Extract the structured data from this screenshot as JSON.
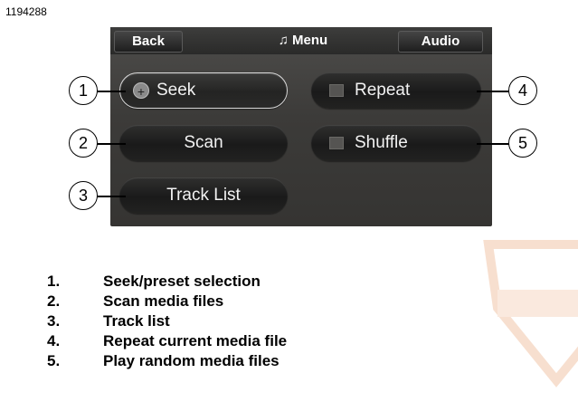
{
  "figure_id": "1194288",
  "topbar": {
    "back_label": "Back",
    "title": "Menu",
    "title_icon": "music-note-icon",
    "audio_label": "Audio"
  },
  "buttons": {
    "seek": "Seek",
    "scan": "Scan",
    "track_list": "Track List",
    "repeat": "Repeat",
    "shuffle": "Shuffle"
  },
  "callouts": [
    "1",
    "2",
    "3",
    "4",
    "5"
  ],
  "legend": [
    {
      "num": "1.",
      "text": "Seek/preset selection"
    },
    {
      "num": "2.",
      "text": "Scan media files"
    },
    {
      "num": "3.",
      "text": "Track list"
    },
    {
      "num": "4.",
      "text": "Repeat current media file"
    },
    {
      "num": "5.",
      "text": "Play random media files"
    }
  ],
  "colors": {
    "screen_bg": "#3c3b39",
    "button_bg": "#1a1a1a",
    "text": "#f2f2f2",
    "watermark": "#f3c7a6"
  }
}
